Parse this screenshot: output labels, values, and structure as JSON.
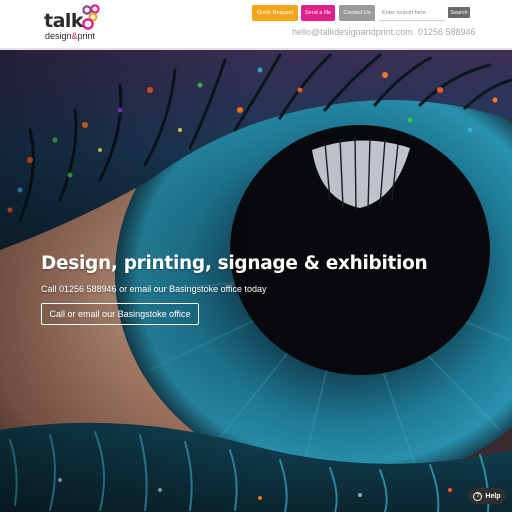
{
  "brand": {
    "logo_word": "talk",
    "logo_sub_a": "design",
    "logo_sub_amp": "&",
    "logo_sub_b": "print",
    "colors": {
      "orange": "#f4a51c",
      "pink": "#e21f8a",
      "grey": "#9a9a9a",
      "purple": "#7d4a9c"
    }
  },
  "header": {
    "buttons": {
      "quote": "Quick Request",
      "file": "Send a file",
      "contact": "Contact Us"
    },
    "search": {
      "placeholder": "Enter search here",
      "button": "Search"
    },
    "email": "hello@talkdesignandprint.com",
    "phone": "01256 588946"
  },
  "hero": {
    "title": "Design, printing, signage & exhibition",
    "subtitle": "Call 01256 588946 or email our Basingstoke office today",
    "cta": "Call or email our Basingstoke office"
  },
  "help": {
    "label": "Help",
    "icon": "question-icon"
  }
}
